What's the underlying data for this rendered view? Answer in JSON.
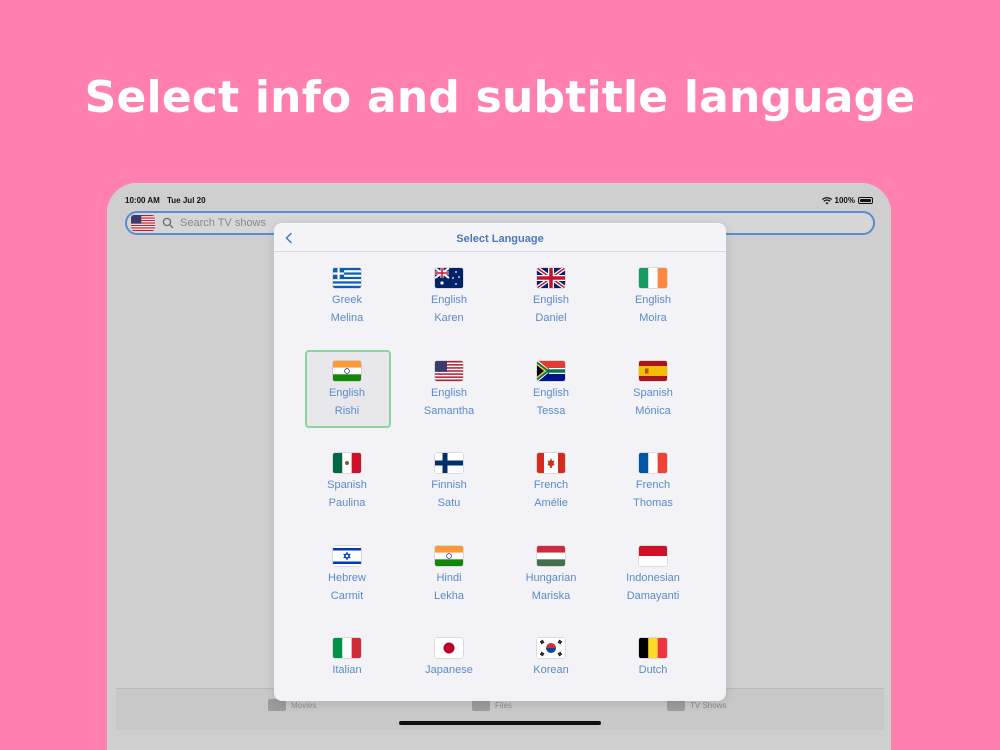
{
  "headline": "Select info and subtitle language",
  "status": {
    "time": "10:00 AM",
    "date": "Tue Jul 20",
    "battery": "100%"
  },
  "search": {
    "placeholder": "Search TV shows"
  },
  "tabs": [
    {
      "label": "Movies",
      "icon": "movies-icon"
    },
    {
      "label": "Files",
      "icon": "files-icon"
    },
    {
      "label": "TV Shows",
      "icon": "tv-icon"
    }
  ],
  "modal": {
    "title": "Select Language",
    "selected_index": 5,
    "items": [
      {
        "lang": "Greek",
        "voice": "Melina",
        "flag": "greece"
      },
      {
        "lang": "English",
        "voice": "Karen",
        "flag": "australia"
      },
      {
        "lang": "English",
        "voice": "Daniel",
        "flag": "uk"
      },
      {
        "lang": "English",
        "voice": "Moira",
        "flag": "ireland"
      },
      {
        "lang": "English",
        "voice": "Rishi",
        "flag": "india"
      },
      {
        "lang": "English",
        "voice": "Samantha",
        "flag": "usa"
      },
      {
        "lang": "English",
        "voice": "Tessa",
        "flag": "south-africa"
      },
      {
        "lang": "Spanish",
        "voice": "Mónica",
        "flag": "spain"
      },
      {
        "lang": "Spanish",
        "voice": "Paulina",
        "flag": "mexico"
      },
      {
        "lang": "Finnish",
        "voice": "Satu",
        "flag": "finland"
      },
      {
        "lang": "French",
        "voice": "Amélie",
        "flag": "canada"
      },
      {
        "lang": "French",
        "voice": "Thomas",
        "flag": "france"
      },
      {
        "lang": "Hebrew",
        "voice": "Carmit",
        "flag": "israel"
      },
      {
        "lang": "Hindi",
        "voice": "Lekha",
        "flag": "india"
      },
      {
        "lang": "Hungarian",
        "voice": "Mariska",
        "flag": "hungary"
      },
      {
        "lang": "Indonesian",
        "voice": "Damayanti",
        "flag": "indonesia"
      },
      {
        "lang": "Italian",
        "voice": "",
        "flag": "italy"
      },
      {
        "lang": "Japanese",
        "voice": "",
        "flag": "japan"
      },
      {
        "lang": "Korean",
        "voice": "",
        "flag": "korea"
      },
      {
        "lang": "Dutch",
        "voice": "",
        "flag": "belgium"
      }
    ]
  },
  "colors": {
    "background": "#FF80AF",
    "accent": "#5B8BC8",
    "selection": "#8BD4A2"
  }
}
